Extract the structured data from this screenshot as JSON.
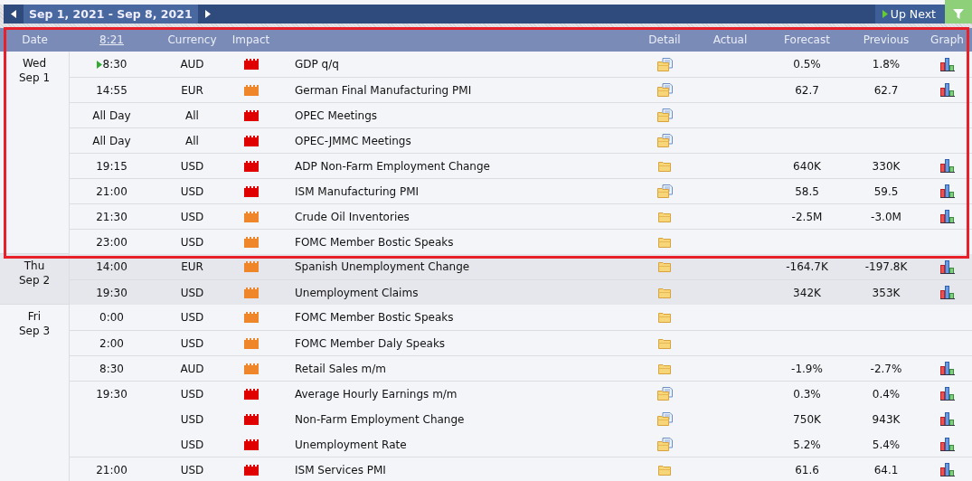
{
  "toolbar": {
    "range": "Sep 1, 2021 - Sep 8, 2021",
    "up_next": "Up Next"
  },
  "table": {
    "columns": [
      {
        "label": "Date"
      },
      {
        "label": "8:21",
        "kind": "link"
      },
      {
        "label": "Currency"
      },
      {
        "label": "Impact"
      },
      {
        "label": "Detail"
      },
      {
        "label": "Actual"
      },
      {
        "label": "Forecast"
      },
      {
        "label": "Previous"
      },
      {
        "label": "Graph"
      }
    ],
    "days": [
      {
        "day": "Wed",
        "date": "Sep 1",
        "highlighted": true,
        "rows": [
          {
            "time": "8:30",
            "next": true,
            "currency": "AUD",
            "color": "#e00000",
            "event": "GDP q/q",
            "kind": "report",
            "forecast": "0.5%",
            "previous": "1.8%",
            "graph": true
          },
          {
            "time": "14:55",
            "next": false,
            "currency": "EUR",
            "color": "#f0862a",
            "event": "German Final Manufacturing PMI",
            "kind": "report",
            "forecast": "62.7",
            "previous": "62.7",
            "graph": true
          },
          {
            "time": "All Day",
            "next": false,
            "currency": "All",
            "color": "#e00000",
            "event": "OPEC Meetings",
            "kind": "report",
            "graph": false
          },
          {
            "time": "All Day",
            "next": false,
            "currency": "All",
            "color": "#e00000",
            "event": "OPEC-JMMC Meetings",
            "kind": "report",
            "graph": false
          },
          {
            "time": "19:15",
            "next": false,
            "currency": "USD",
            "color": "#e00000",
            "event": "ADP Non-Farm Employment Change",
            "kind": "folder",
            "forecast": "640K",
            "previous": "330K",
            "graph": true
          },
          {
            "time": "21:00",
            "next": false,
            "currency": "USD",
            "color": "#e00000",
            "event": "ISM Manufacturing PMI",
            "kind": "report",
            "forecast": "58.5",
            "previous": "59.5",
            "graph": true
          },
          {
            "time": "21:30",
            "next": false,
            "currency": "USD",
            "color": "#f0862a",
            "event": "Crude Oil Inventories",
            "kind": "folder",
            "forecast": "-2.5M",
            "previous": "-3.0M",
            "graph": true
          },
          {
            "time": "23:00",
            "next": false,
            "currency": "USD",
            "color": "#f0862a",
            "event": "FOMC Member Bostic Speaks",
            "kind": "folder",
            "graph": false
          }
        ]
      },
      {
        "day": "Thu",
        "date": "Sep 2",
        "highlighted": false,
        "rows": [
          {
            "time": "14:00",
            "next": false,
            "currency": "EUR",
            "color": "#f0862a",
            "event": "Spanish Unemployment Change",
            "kind": "folder",
            "forecast": "-164.7K",
            "previous": "-197.8K",
            "graph": true
          },
          {
            "time": "19:30",
            "next": false,
            "currency": "USD",
            "color": "#f0862a",
            "event": "Unemployment Claims",
            "kind": "folder",
            "forecast": "342K",
            "previous": "353K",
            "graph": true
          }
        ]
      },
      {
        "day": "Fri",
        "date": "Sep 3",
        "highlighted": false,
        "rows": [
          {
            "time": "0:00",
            "next": false,
            "currency": "USD",
            "color": "#f0862a",
            "event": "FOMC Member Bostic Speaks",
            "kind": "folder",
            "graph": false
          },
          {
            "time": "2:00",
            "next": false,
            "currency": "USD",
            "color": "#f0862a",
            "event": "FOMC Member Daly Speaks",
            "kind": "folder",
            "graph": false
          },
          {
            "time": "8:30",
            "next": false,
            "currency": "AUD",
            "color": "#f0862a",
            "event": "Retail Sales m/m",
            "kind": "folder",
            "forecast": "-1.9%",
            "previous": "-2.7%",
            "graph": true
          },
          {
            "time": "19:30",
            "next": false,
            "currency": "USD",
            "color": "#e00000",
            "event": "Average Hourly Earnings m/m",
            "kind": "report",
            "forecast": "0.3%",
            "previous": "0.4%",
            "graph": true
          },
          {
            "next": false,
            "currency": "USD",
            "color": "#e00000",
            "event": "Non-Farm Employment Change",
            "kind": "report",
            "forecast": "750K",
            "previous": "943K",
            "graph": true
          },
          {
            "next": false,
            "currency": "USD",
            "color": "#e00000",
            "event": "Unemployment Rate",
            "kind": "report",
            "forecast": "5.2%",
            "previous": "5.4%",
            "graph": true
          },
          {
            "time": "21:00",
            "next": false,
            "currency": "USD",
            "color": "#e00000",
            "event": "ISM Services PMI",
            "kind": "folder",
            "forecast": "61.6",
            "previous": "64.1",
            "graph": true
          }
        ]
      }
    ]
  }
}
